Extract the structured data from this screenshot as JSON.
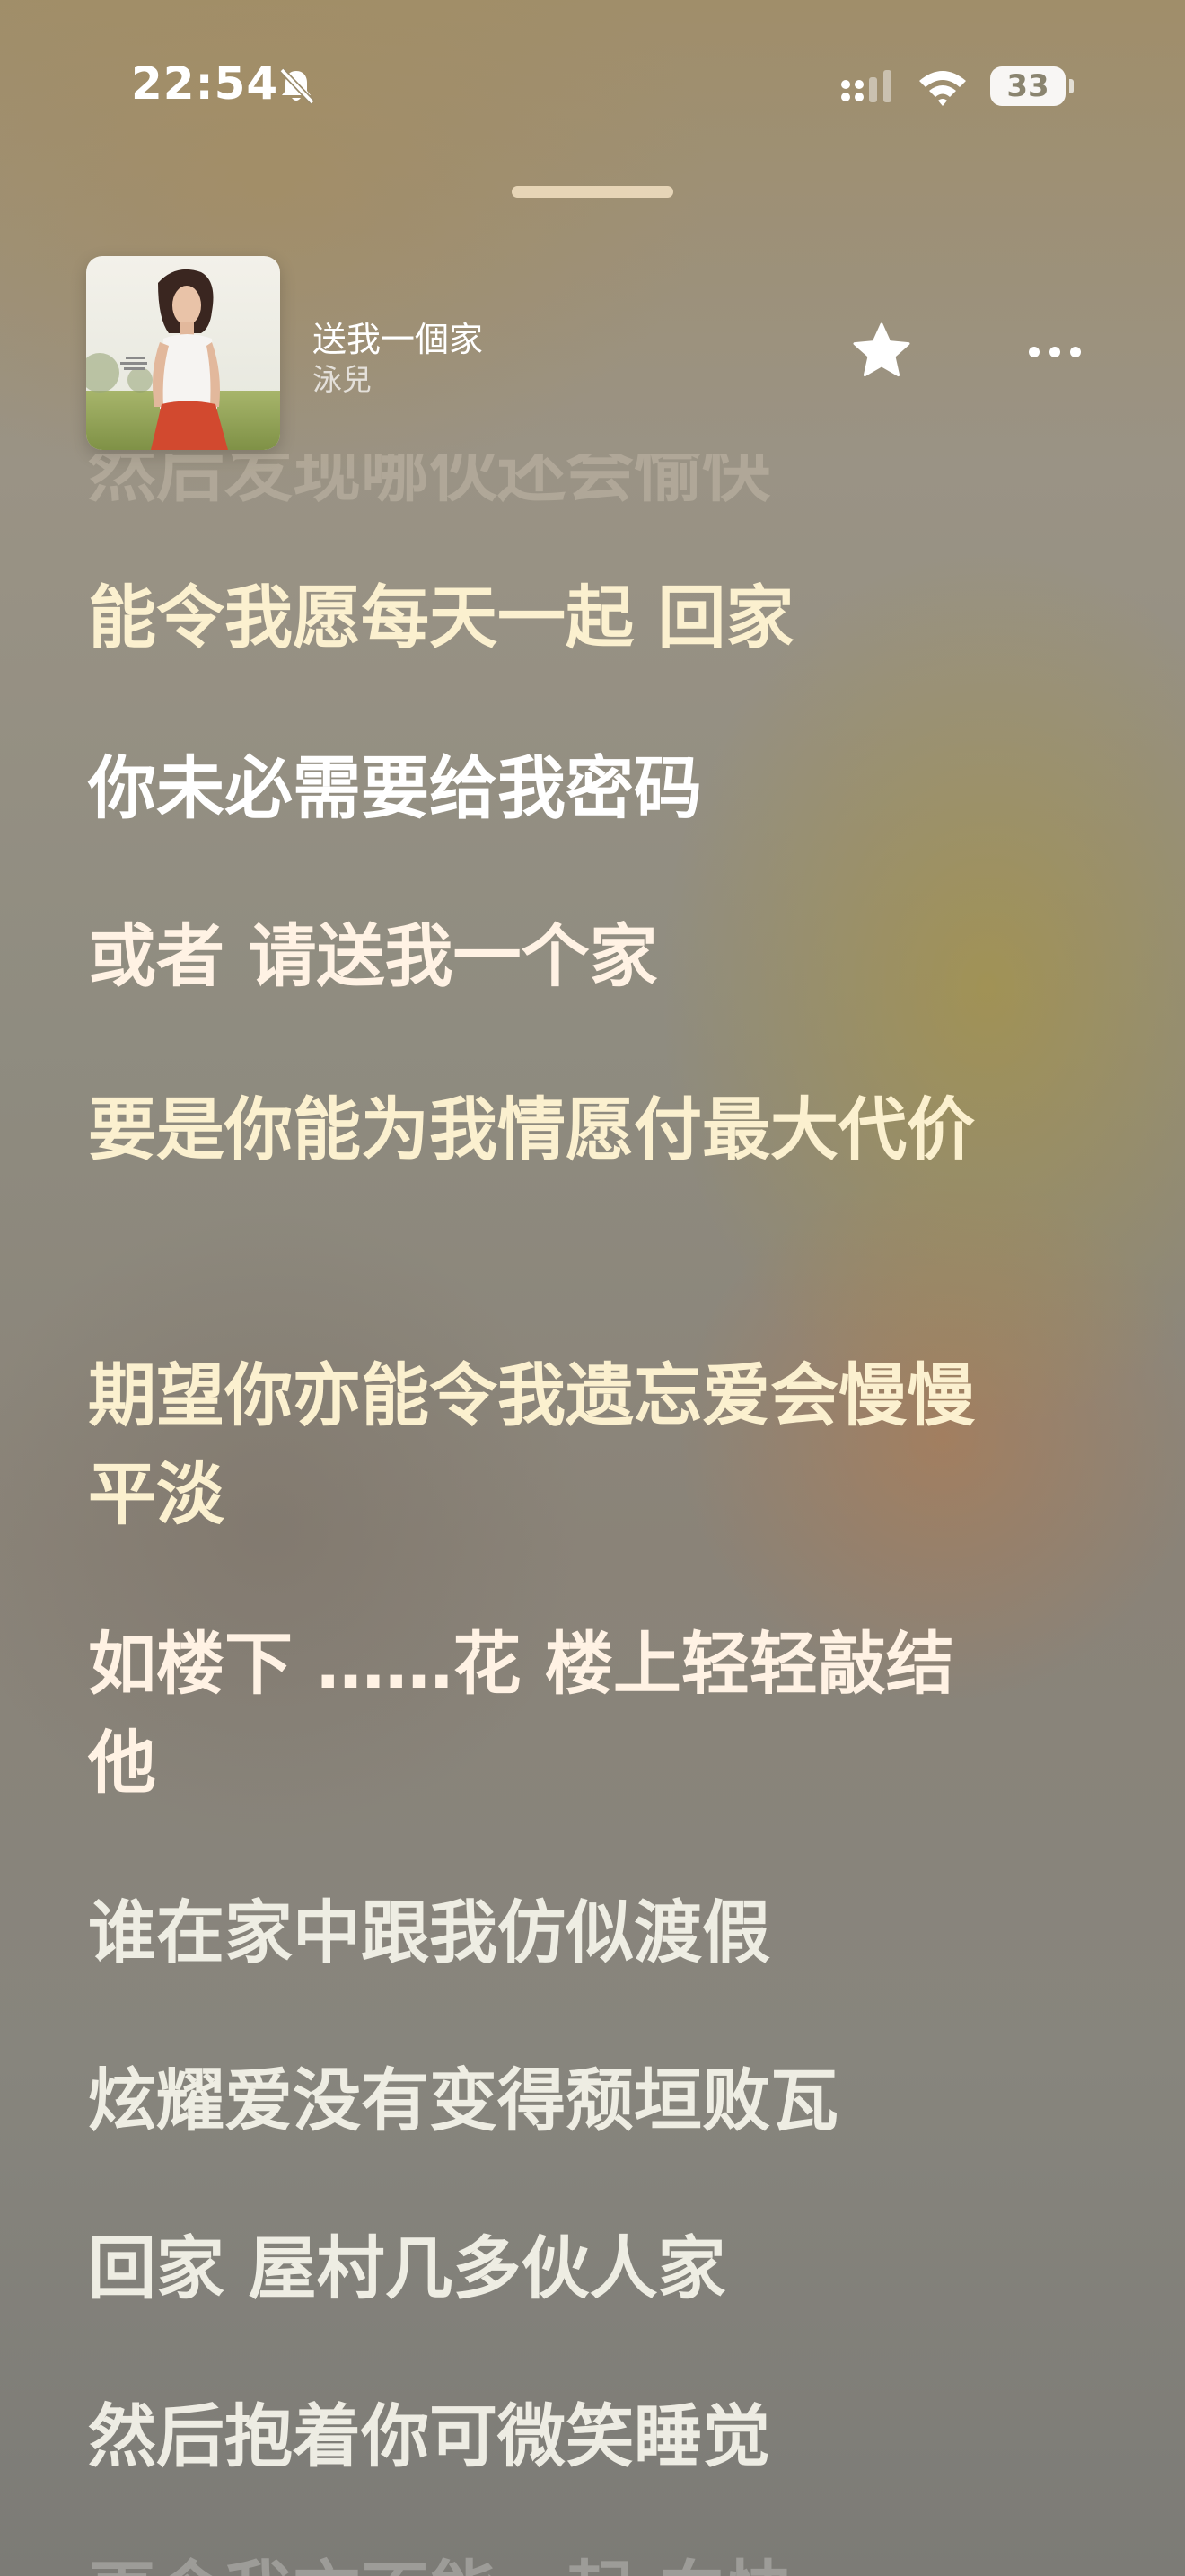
{
  "status_bar": {
    "time": "22:54",
    "battery": "33",
    "icons": [
      "bell-slash-icon",
      "cellular-signal-icon",
      "wifi-icon",
      "battery-icon"
    ]
  },
  "now_playing": {
    "title": "送我一個家",
    "artist": "泳兒",
    "favorite_icon": "star-icon",
    "more_icon": "ellipsis-icon"
  },
  "lyrics": {
    "partial_top": "然后发现哪伙还会愉快",
    "lines": [
      "能令我愿每天一起 回家",
      "你未必需要给我密码",
      "或者 请送我一个家",
      "要是你能为我情愿付最大代价",
      "期望你亦能令我遗忘爱会慢慢平淡",
      "如楼下 ……花 楼上轻轻敲结他",
      "谁在家中跟我仿似渡假",
      "炫耀爱没有变得颓垣败瓦",
      "回家 屋村几多伙人家",
      "然后抱着你可微笑睡觉"
    ],
    "active_index": 1,
    "partial_bottom": "再令我亦不能一起 向快"
  },
  "colors": {
    "background_top": "#a08e6a",
    "background_bottom": "#7c7b76",
    "lyric_text": "#fff2e4",
    "active_lyric": "#ffffff"
  }
}
